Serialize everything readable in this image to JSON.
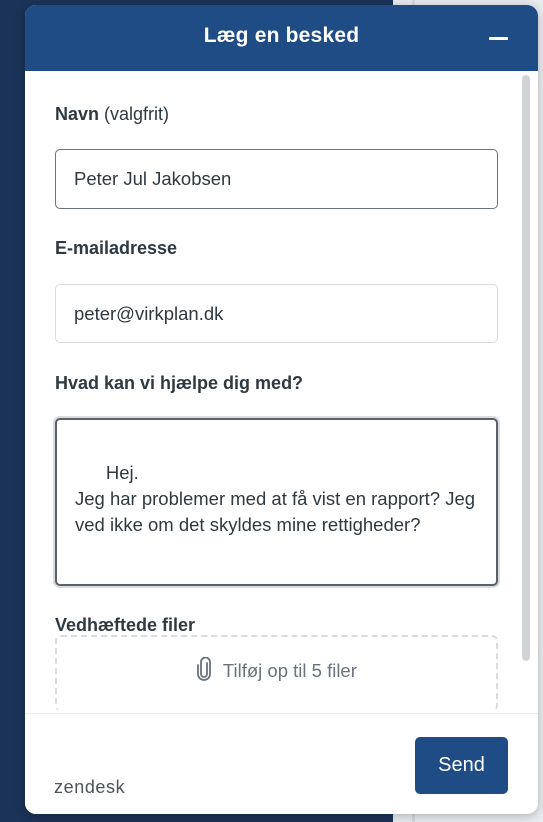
{
  "header": {
    "title": "Læg en besked",
    "minimize_icon": "minimize-icon"
  },
  "form": {
    "name": {
      "label": "Navn",
      "optional": "(valgfrit)",
      "value": "Peter Jul Jakobsen"
    },
    "email": {
      "label": "E-mailadresse",
      "value": "peter@virkplan.dk"
    },
    "message": {
      "label": "Hvad kan vi hjælpe dig med?",
      "value": "Hej.\nJeg har problemer med at få vist en rapport? Jeg ved ikke om det skyldes mine rettigheder?"
    },
    "attachments": {
      "label": "Vedhæftede filer",
      "dropzone_text": "Tilføj op til 5 filer",
      "icon": "paperclip-icon"
    }
  },
  "footer": {
    "brand": "zendesk",
    "send_label": "Send"
  },
  "colors": {
    "primary": "#1f4c84",
    "page_bg": "#1b3358",
    "text": "#2f3941",
    "muted": "#68737d"
  }
}
